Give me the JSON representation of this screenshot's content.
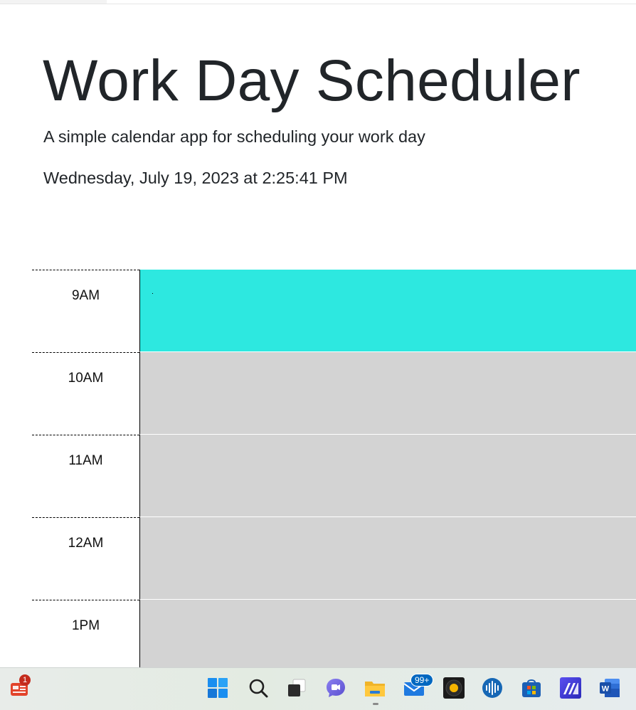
{
  "header": {
    "title": "Work Day Scheduler",
    "lead": "A simple calendar app for scheduling your work day",
    "current_day": "Wednesday, July 19, 2023 at 2:25:41 PM"
  },
  "schedule": {
    "rows": [
      {
        "hour": "9AM",
        "state": "present",
        "text": "."
      },
      {
        "hour": "10AM",
        "state": "past",
        "text": ""
      },
      {
        "hour": "11AM",
        "state": "past",
        "text": ""
      },
      {
        "hour": "12AM",
        "state": "past",
        "text": ""
      },
      {
        "hour": "1PM",
        "state": "past",
        "text": ""
      }
    ],
    "colors": {
      "present": "#2de8e0",
      "past": "#d3d3d3"
    }
  },
  "taskbar": {
    "items": [
      {
        "name": "news-widget-icon",
        "badge": "1"
      },
      {
        "name": "start-icon"
      },
      {
        "name": "search-icon"
      },
      {
        "name": "task-view-icon"
      },
      {
        "name": "chat-icon"
      },
      {
        "name": "file-explorer-icon"
      },
      {
        "name": "mail-icon",
        "badge": "99+"
      },
      {
        "name": "media-player-icon"
      },
      {
        "name": "audio-app-icon"
      },
      {
        "name": "store-icon"
      },
      {
        "name": "editor-app-icon"
      },
      {
        "name": "word-icon"
      }
    ]
  }
}
